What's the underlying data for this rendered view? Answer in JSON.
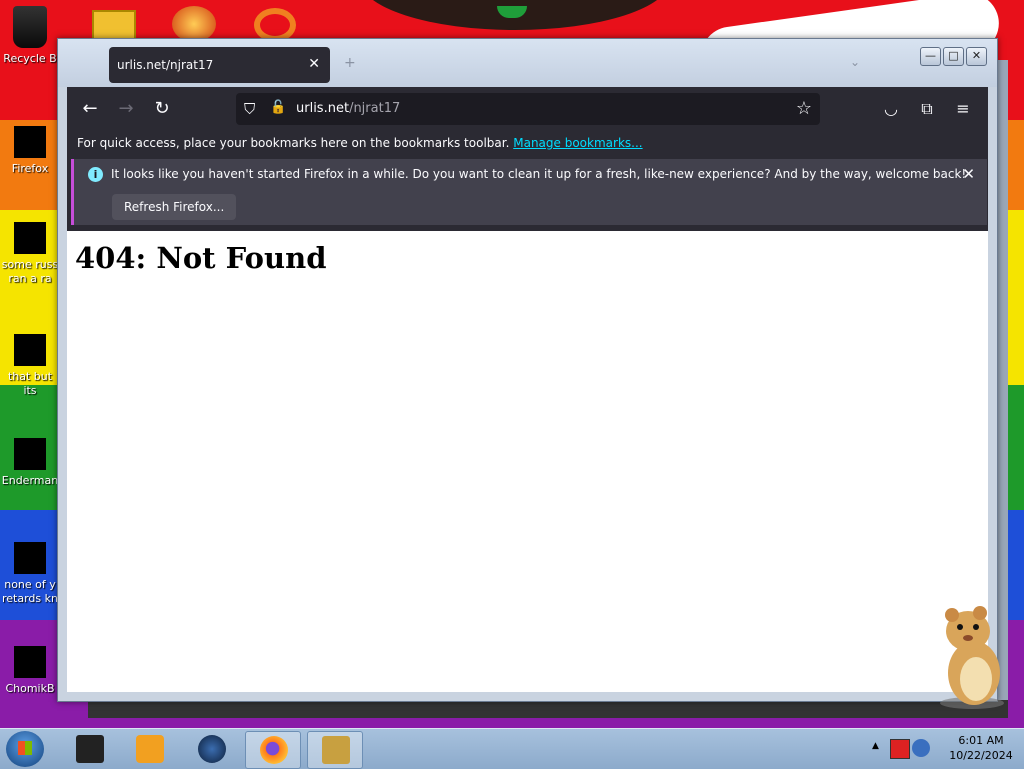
{
  "desktop": {
    "icons": [
      {
        "label": "Recycle B"
      },
      {
        "label": "Firefox"
      },
      {
        "label": "some russ ran a ra"
      },
      {
        "label": "that but its"
      },
      {
        "label": "Enderman"
      },
      {
        "label": "none of y retards kn"
      },
      {
        "label": "ChomikB"
      }
    ]
  },
  "browser": {
    "tab": {
      "title": "urlis.net/njrat17",
      "close_glyph": "✕"
    },
    "newtab_glyph": "+",
    "window_buttons": {
      "minimize": "—",
      "maximize": "□",
      "close": "✕"
    },
    "urlbar": {
      "host": "urlis.net",
      "path": "/njrat17"
    },
    "bookmarks_bar": {
      "text": "For quick access, place your bookmarks here on the bookmarks toolbar.",
      "link": "Manage bookmarks..."
    },
    "notice": {
      "text": "It looks like you haven't started Firefox in a while. Do you want to clean it up for a fresh, like-new experience? And by the way, welcome back!",
      "button": "Refresh Firefox...",
      "close_glyph": "✕"
    }
  },
  "page": {
    "heading": "404: Not Found"
  },
  "taskbar": {
    "clock_time": "6:01 AM",
    "clock_date": "10/22/2024"
  },
  "colors": {
    "firefox_chrome": "#2b2a33",
    "urlbar_bg": "#1c1b22",
    "link": "#00ddff",
    "notice_bg": "#42414d"
  }
}
